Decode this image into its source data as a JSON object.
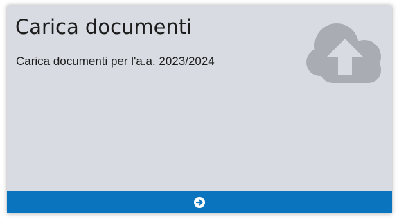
{
  "card": {
    "title": "Carica documenti",
    "subtitle": "Carica documenti per l'a.a. 2023/2024",
    "icon": "cloud-upload-icon",
    "footer_icon": "arrow-circle-right-icon"
  },
  "colors": {
    "card_background": "#d8dce2",
    "footer_background": "#0b74bf",
    "icon_color": "#a9adb3",
    "text_color": "#1c1c1c"
  }
}
